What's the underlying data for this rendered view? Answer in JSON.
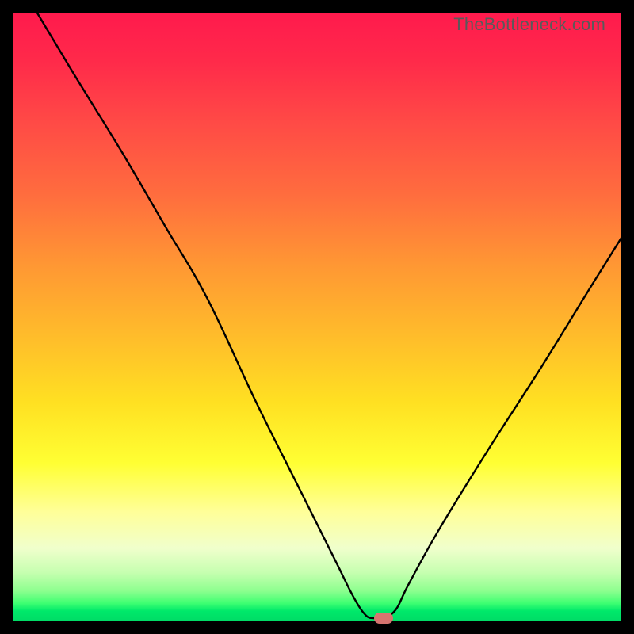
{
  "attribution": "TheBottleneck.com",
  "colors": {
    "curve_stroke": "#000000",
    "marker_fill": "#d6746f",
    "frame_bg": "#000000"
  },
  "layout": {
    "image_size": 800,
    "plot_inset": 16,
    "plot_size": 768
  },
  "chart_data": {
    "type": "line",
    "title": "",
    "xlabel": "",
    "ylabel": "",
    "xlim": [
      0,
      100
    ],
    "ylim": [
      0,
      100
    ],
    "x": [
      4,
      10,
      18,
      25,
      32,
      40,
      47,
      53,
      56,
      58,
      59.5,
      61,
      63,
      65,
      70,
      78,
      87,
      95,
      100
    ],
    "y": [
      100,
      90,
      77,
      65,
      53,
      36,
      22,
      10,
      4,
      1,
      0.5,
      0.5,
      2,
      6,
      15,
      28,
      42,
      55,
      63
    ],
    "marker": {
      "x": 61,
      "y": 0.5
    },
    "notes": "Values are estimated from pixel positions on a 0–100 normalized axis; the chart has no visible tick labels, axis titles, legend, or gridlines."
  }
}
